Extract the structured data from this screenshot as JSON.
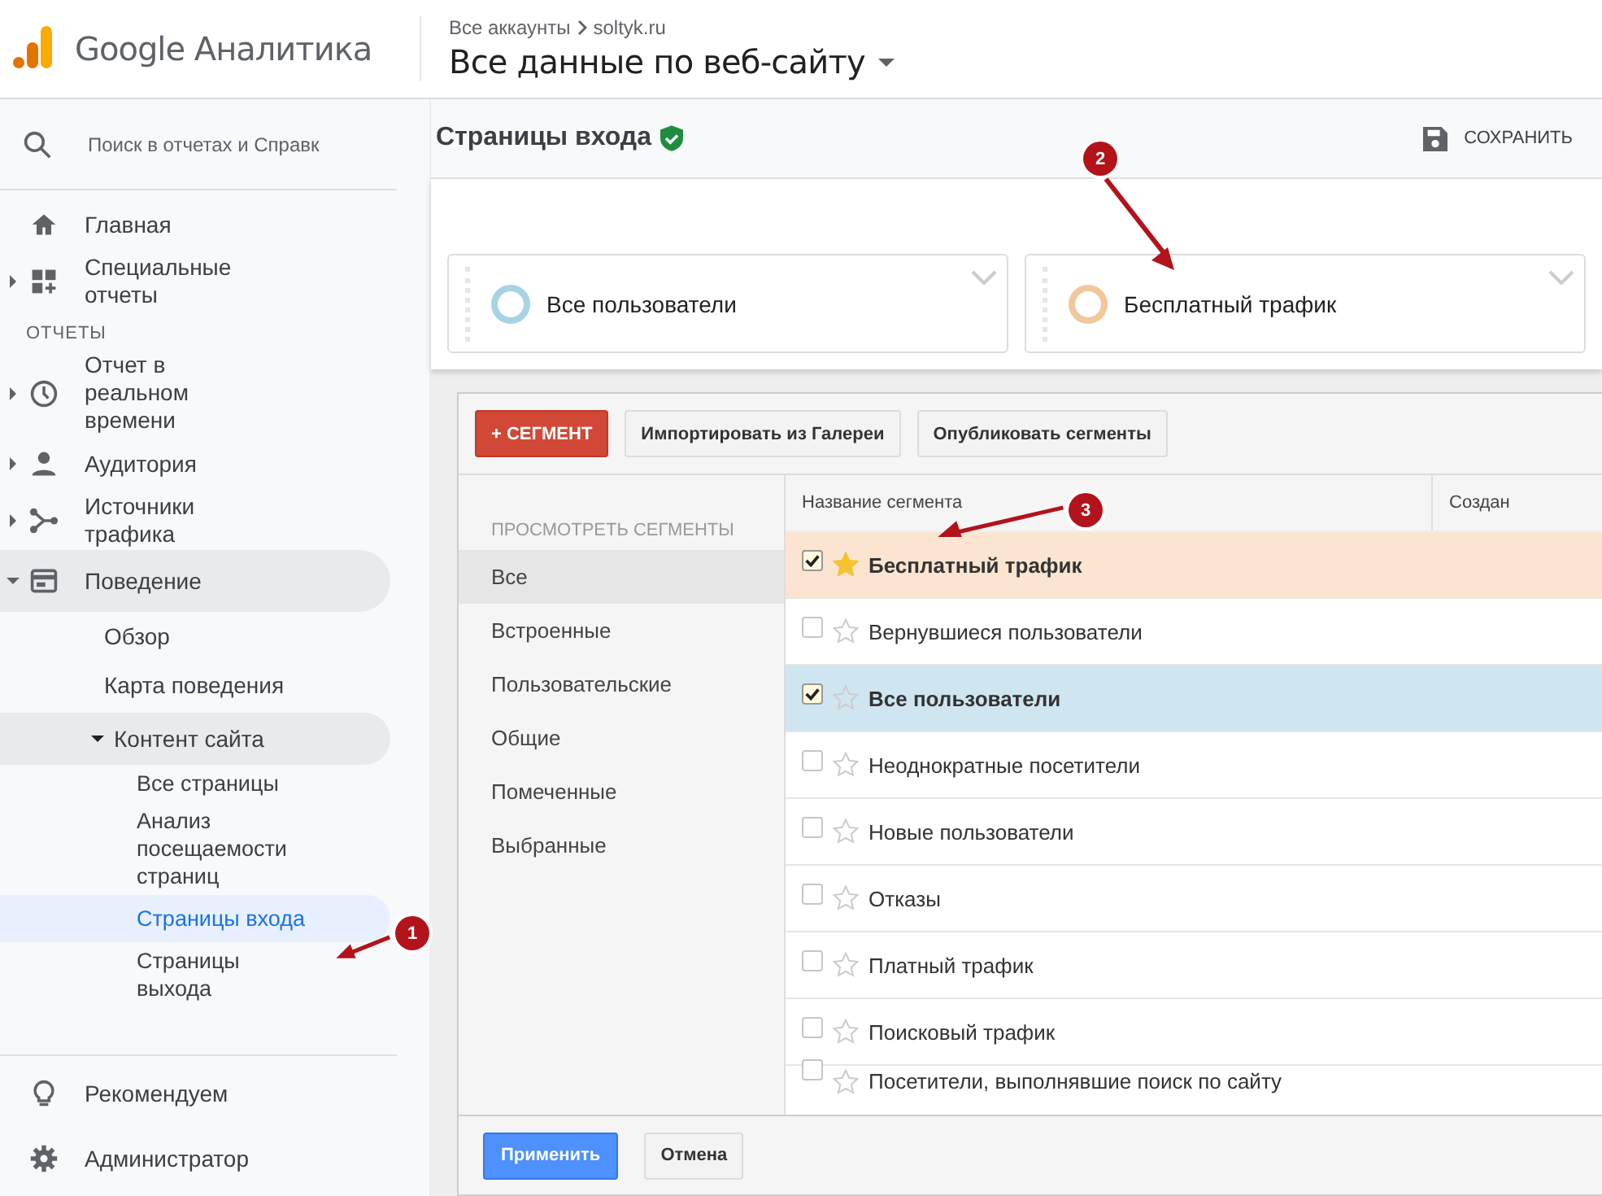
{
  "header": {
    "product": "Google Аналитика",
    "breadcrumb": [
      "Все аккаунты",
      "soltyk.ru"
    ],
    "view": "Все данные по веб-сайту"
  },
  "sidebar": {
    "search": {
      "placeholder": "Поиск в отчетах и Справк"
    },
    "top_items": [
      {
        "kind": "home",
        "label": "Главная",
        "expandable": false
      },
      {
        "kind": "custom",
        "label": "Специальные отчеты",
        "expandable": true
      }
    ],
    "section": "ОТЧЕТЫ",
    "items": [
      {
        "kind": "clock",
        "label": "Отчет в реальном времени",
        "expanded": false
      },
      {
        "kind": "person",
        "label": "Аудитория",
        "expanded": false
      },
      {
        "kind": "fork",
        "label": "Источники трафика",
        "expanded": false
      },
      {
        "kind": "card",
        "label": "Поведение",
        "expanded": true,
        "children": [
          {
            "label": "Обзор",
            "selected": false
          },
          {
            "label": "Карта поведения",
            "selected": false
          },
          {
            "label": "Контент сайта",
            "expanded": true,
            "selected": false,
            "children": [
              {
                "label": "Все страницы",
                "selected": false
              },
              {
                "label": "Анализ посещаемости страниц",
                "selected": false
              },
              {
                "label": "Страницы входа",
                "selected": true
              },
              {
                "label": "Страницы выхода",
                "selected": false
              }
            ]
          }
        ]
      }
    ],
    "bottom_items": [
      {
        "kind": "bulb",
        "label": "Рекомендуем"
      },
      {
        "kind": "gear",
        "label": "Администратор"
      }
    ]
  },
  "page": {
    "title": "Страницы входа",
    "save": "СОХРАНИТЬ"
  },
  "segment_cards": [
    {
      "label": "Все пользователи",
      "color": "#a7d3e6"
    },
    {
      "label": "Бесплатный трафик",
      "color": "#f2c79c"
    }
  ],
  "segment_panel": {
    "buttons": [
      {
        "kind": "primary",
        "label": "+ СЕГМЕНТ"
      },
      {
        "kind": "plain",
        "label": "Импортировать из Галереи"
      },
      {
        "kind": "plain",
        "label": "Опубликовать сегменты"
      }
    ],
    "filter_heading": "ПРОСМОТРЕТЬ СЕГМЕНТЫ",
    "filters": [
      {
        "label": "Все",
        "selected": true
      },
      {
        "label": "Встроенные",
        "selected": false
      },
      {
        "label": "Пользовательские",
        "selected": false
      },
      {
        "label": "Общие",
        "selected": false
      },
      {
        "label": "Помеченные",
        "selected": false
      },
      {
        "label": "Выбранные",
        "selected": false
      }
    ],
    "columns": [
      "Название сегмента",
      "Создан"
    ],
    "rows": [
      {
        "name": "Бесплатный трафик",
        "checked": true,
        "starred": true,
        "color": "#fbe5d0"
      },
      {
        "name": "Вернувшиеся пользователи",
        "checked": false,
        "starred": false
      },
      {
        "name": "Все пользователи",
        "checked": true,
        "starred": false,
        "color": "#cfe6f1"
      },
      {
        "name": "Неоднократные посетители",
        "checked": false,
        "starred": false
      },
      {
        "name": "Новые пользователи",
        "checked": false,
        "starred": false
      },
      {
        "name": "Отказы",
        "checked": false,
        "starred": false
      },
      {
        "name": "Платный трафик",
        "checked": false,
        "starred": false
      },
      {
        "name": "Поисковый трафик",
        "checked": false,
        "starred": false
      },
      {
        "name": "Посетители, выполнявшие поиск по сайту",
        "checked": false,
        "starred": false
      }
    ],
    "footer_buttons": [
      {
        "kind": "primary",
        "label": "Применить"
      },
      {
        "kind": "plain",
        "label": "Отмена"
      }
    ]
  },
  "callouts": [
    {
      "number": "1"
    },
    {
      "number": "2"
    },
    {
      "number": "3"
    }
  ]
}
